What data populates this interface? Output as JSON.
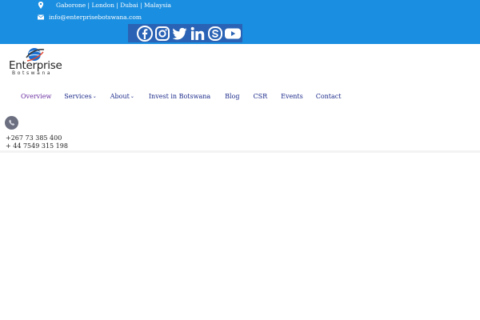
{
  "topbar": {
    "locations": "Gaborone | London | Dubai | Malaysia",
    "email": "info@enterprisebotswana.com",
    "social_icons": [
      "facebook-icon",
      "instagram-icon",
      "twitter-icon",
      "linkedin-icon",
      "skype-icon",
      "youtube-icon"
    ]
  },
  "logo": {
    "word": "Enterprise",
    "sub": "Botswana"
  },
  "nav": {
    "items": [
      {
        "label": "Overview",
        "caret": ""
      },
      {
        "label": "Services",
        "caret": "⌄"
      },
      {
        "label": "About",
        "caret": "⌄"
      },
      {
        "label": "Invest in Botswana",
        "caret": ""
      },
      {
        "label": "Blog",
        "caret": ""
      },
      {
        "label": "CSR",
        "caret": ""
      },
      {
        "label": "Events",
        "caret": ""
      },
      {
        "label": "Contact",
        "caret": ""
      }
    ]
  },
  "contact": {
    "phone_1": "+267 73 385 400",
    "phone_2": "+ 44 7549 315 198"
  },
  "colors": {
    "topbar": "#1a8ee0",
    "social_bg": "#2a63b5",
    "nav_text": "#1b2a8a",
    "nav_active": "#6a2ea0"
  }
}
